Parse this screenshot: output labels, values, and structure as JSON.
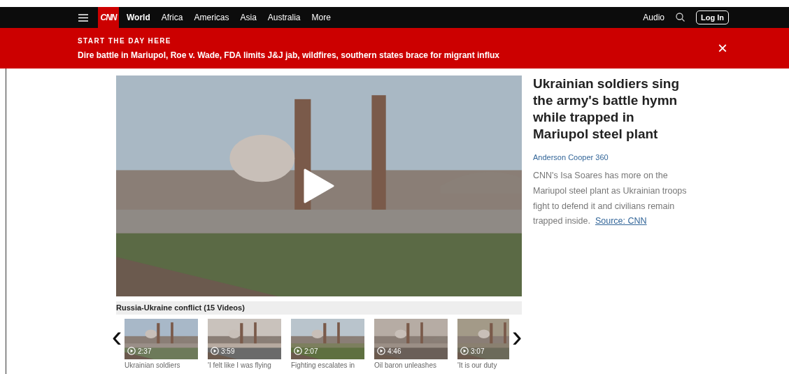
{
  "nav": {
    "logo": "CNN",
    "section": "World",
    "links": [
      "Africa",
      "Americas",
      "Asia",
      "Australia",
      "More"
    ],
    "audio": "Audio",
    "login": "Log In"
  },
  "banner": {
    "kicker": "START THE DAY HERE",
    "headline": "Dire battle in Mariupol, Roe v. Wade, FDA limits J&J jab, wildfires, southern states brace for migrant influx",
    "close": "×"
  },
  "story": {
    "title": "Ukrainian soldiers sing the army's battle hymn while trapped in Mariupol steel plant",
    "show": "Anderson Cooper 360",
    "description": "CNN's Isa Soares has more on the Mariupol steel plant as Ukrainian troops fight to defend it and civilians remain trapped inside.",
    "source": "Source: CNN"
  },
  "playlist": {
    "title": "Russia-Ukraine conflict (15 Videos)",
    "prev": "‹",
    "next": "›",
    "videos": [
      {
        "duration": "2:37",
        "caption": "Ukrainian soldiers"
      },
      {
        "duration": "3:59",
        "caption": "'I felt like I was flying"
      },
      {
        "duration": "2:07",
        "caption": "Fighting escalates in"
      },
      {
        "duration": "4:46",
        "caption": "Oil baron unleashes"
      },
      {
        "duration": "3:07",
        "caption": "'It is our duty"
      }
    ]
  }
}
